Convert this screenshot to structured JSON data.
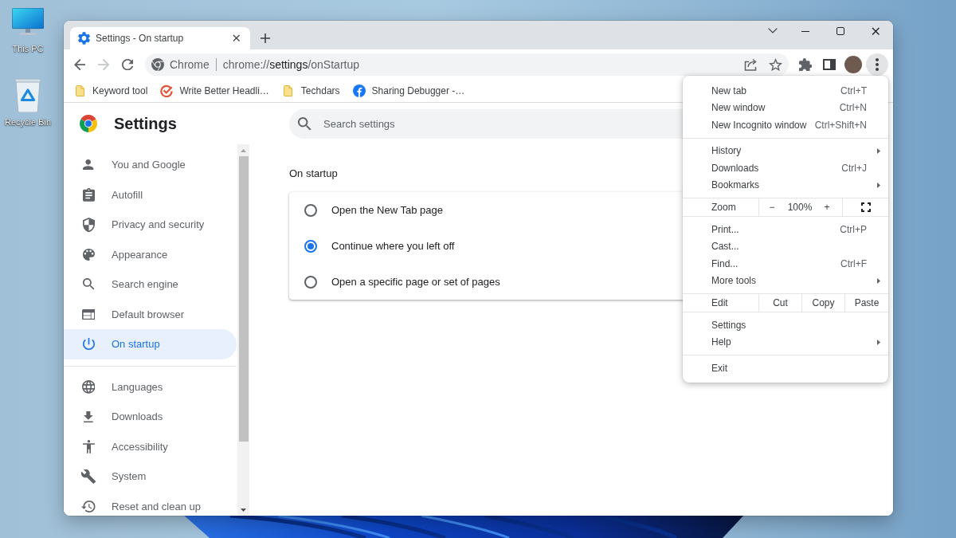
{
  "desktop": {
    "icons": [
      {
        "label": "This PC"
      },
      {
        "label": "Recycle Bin"
      }
    ]
  },
  "window": {
    "tabs": [
      {
        "title": "Settings - On startup",
        "selected": true
      }
    ],
    "toolbar": {
      "back": {
        "disabled": false
      },
      "forward": {
        "disabled": true
      },
      "site_label": "Chrome",
      "url": {
        "scheme": "chrome://",
        "host": "settings",
        "path": "/onStartup"
      },
      "menu_open": true
    },
    "bookmarks": [
      {
        "label": "Keyword tool"
      },
      {
        "label": "Write Better Headli…"
      },
      {
        "label": "Techdars"
      },
      {
        "label": "Sharing Debugger -…"
      }
    ]
  },
  "settings": {
    "title": "Settings",
    "search": {
      "placeholder": "Search settings"
    },
    "nav_groups": [
      {
        "items": [
          {
            "label": "You and Google",
            "selected": false
          },
          {
            "label": "Autofill",
            "selected": false
          },
          {
            "label": "Privacy and security",
            "selected": false
          },
          {
            "label": "Appearance",
            "selected": false
          },
          {
            "label": "Search engine",
            "selected": false
          },
          {
            "label": "Default browser",
            "selected": false
          },
          {
            "label": "On startup",
            "selected": true
          }
        ]
      },
      {
        "items": [
          {
            "label": "Languages",
            "selected": false
          },
          {
            "label": "Downloads",
            "selected": false
          },
          {
            "label": "Accessibility",
            "selected": false
          },
          {
            "label": "System",
            "selected": false
          },
          {
            "label": "Reset and clean up",
            "selected": false
          }
        ]
      }
    ],
    "section_title": "On startup",
    "options": [
      {
        "label": "Open the New Tab page",
        "selected": false
      },
      {
        "label": "Continue where you left off",
        "selected": true
      },
      {
        "label": "Open a specific page or set of pages",
        "selected": false
      }
    ]
  },
  "menu": {
    "sections": [
      {
        "items": [
          {
            "kind": "command",
            "label": "New tab",
            "shortcut": "Ctrl+T"
          },
          {
            "kind": "command",
            "label": "New window",
            "shortcut": "Ctrl+N"
          },
          {
            "kind": "command",
            "label": "New Incognito window",
            "shortcut": "Ctrl+Shift+N"
          }
        ]
      },
      {
        "items": [
          {
            "kind": "submenu",
            "label": "History"
          },
          {
            "kind": "command",
            "label": "Downloads",
            "shortcut": "Ctrl+J"
          },
          {
            "kind": "submenu",
            "label": "Bookmarks"
          }
        ]
      },
      {
        "items": [
          {
            "kind": "zoom",
            "label": "Zoom",
            "decrease": "−",
            "value": "100%",
            "increase": "+"
          }
        ]
      },
      {
        "items": [
          {
            "kind": "command",
            "label": "Print...",
            "shortcut": "Ctrl+P"
          },
          {
            "kind": "command",
            "label": "Cast..."
          },
          {
            "kind": "command",
            "label": "Find...",
            "shortcut": "Ctrl+F"
          },
          {
            "kind": "submenu",
            "label": "More tools"
          }
        ]
      },
      {
        "items": [
          {
            "kind": "edit",
            "label": "Edit",
            "actions": [
              "Cut",
              "Copy",
              "Paste"
            ]
          }
        ]
      },
      {
        "items": [
          {
            "kind": "command",
            "label": "Settings"
          },
          {
            "kind": "submenu",
            "label": "Help"
          }
        ]
      },
      {
        "items": [
          {
            "kind": "command",
            "label": "Exit"
          }
        ]
      }
    ]
  }
}
